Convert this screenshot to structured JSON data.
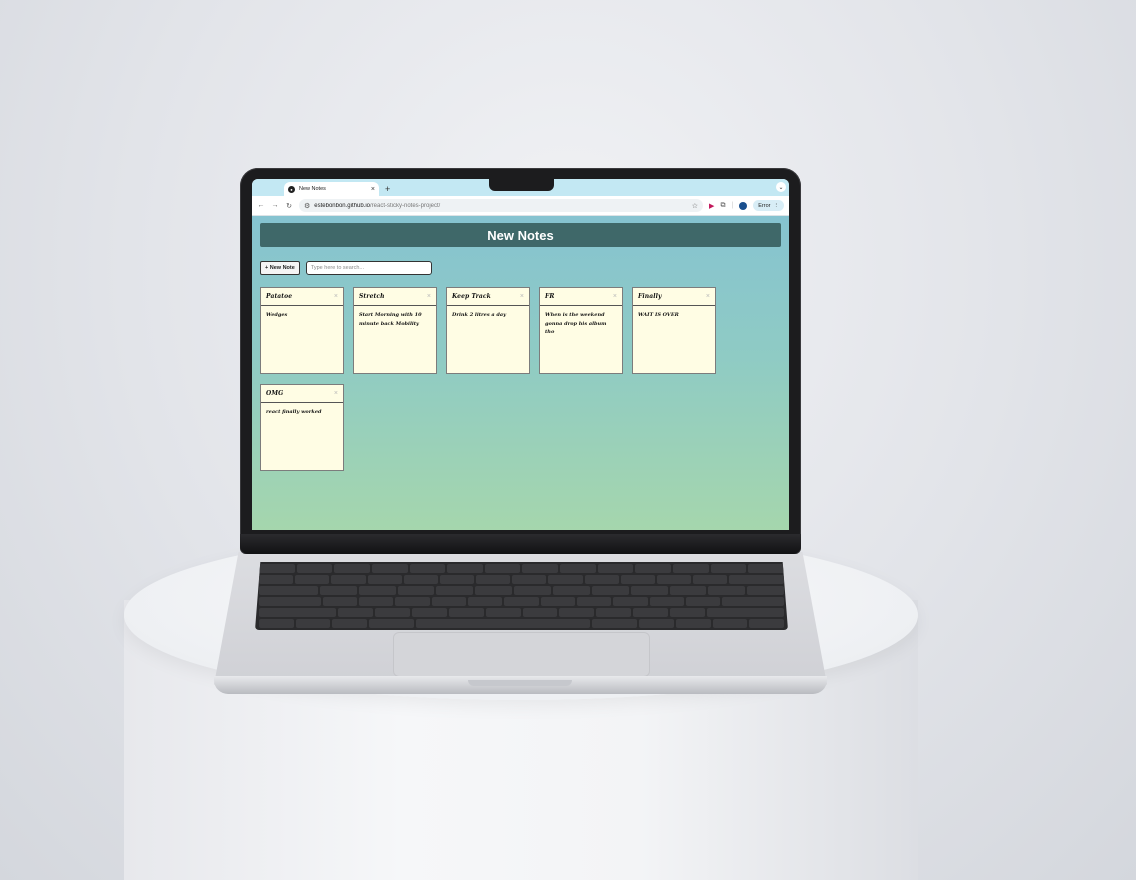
{
  "browser": {
    "tab_title": "New Notes",
    "tab_close": "×",
    "new_tab": "+",
    "url_host": "estebonbon.github.io",
    "url_path": "/react-sticky-notes-project/",
    "profile_status": "Error"
  },
  "app": {
    "header_title": "New Notes",
    "new_note_label": "+ New Note",
    "search_placeholder": "Type here to search...",
    "notes": [
      {
        "title": "Patatoe",
        "body": "Wedges"
      },
      {
        "title": "Stretch",
        "body": "Start Morning with 10 minute back Mobility"
      },
      {
        "title": "Keep Track",
        "body": "Drink 2 litres a day"
      },
      {
        "title": "FR",
        "body": "When is the weekend gonna drop his album tho"
      },
      {
        "title": "Finally",
        "body": "WAIT IS OVER"
      },
      {
        "title": "OMG",
        "body": "react finally worked"
      }
    ],
    "note_close": "×"
  },
  "colors": {
    "header_bg": "#3f6869",
    "note_bg": "#fffde4",
    "page_gradient_top": "#86c3d0",
    "page_gradient_bottom": "#a5d6ad"
  }
}
